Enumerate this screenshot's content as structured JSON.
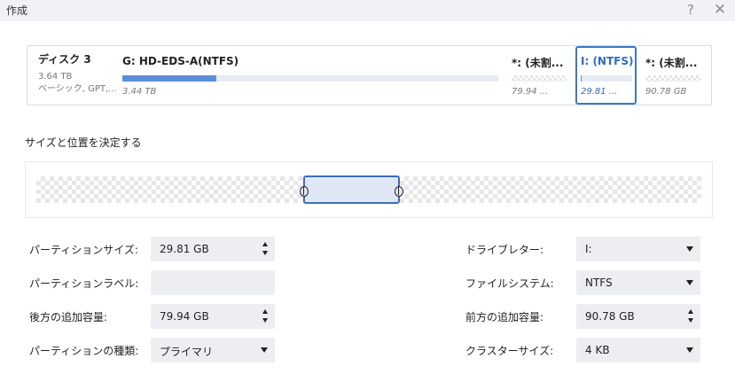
{
  "window": {
    "title": "作成",
    "help_icon": "?",
    "close_icon": "✕"
  },
  "disk": {
    "name": "ディスク 3",
    "size": "3.64 TB",
    "type": "ベーシック, GPT,..."
  },
  "partitions": [
    {
      "name": "G: HD-EDS-A(NTFS)",
      "size": "3.44 TB",
      "used_fraction": 0.25,
      "selected": false,
      "unallocated": false
    },
    {
      "name": "*: (未割...",
      "size": "79.94 ...",
      "selected": false,
      "unallocated": true
    },
    {
      "name": "I: (NTFS)",
      "size": "29.81 ...",
      "used_fraction": 0.02,
      "selected": true,
      "unallocated": false
    },
    {
      "name": "*: (未割...",
      "size": "90.78 GB",
      "selected": false,
      "unallocated": true
    }
  ],
  "section": {
    "label": "サイズと位置を決定する"
  },
  "form": {
    "partition_size": {
      "label": "パーティションサイズ:",
      "value": "29.81 GB"
    },
    "partition_label": {
      "label": "パーティションラベル:",
      "value": ""
    },
    "unallocated_after": {
      "label": "後方の追加容量:",
      "value": "79.94 GB"
    },
    "partition_type": {
      "label": "パーティションの種類:",
      "value": "プライマリ"
    },
    "drive_letter": {
      "label": "ドライブレター:",
      "value": "I:"
    },
    "file_system": {
      "label": "ファイルシステム:",
      "value": "NTFS"
    },
    "unallocated_before": {
      "label": "前方の追加容量:",
      "value": "90.78 GB"
    },
    "cluster_size": {
      "label": "クラスターサイズ:",
      "value": "4 KB"
    }
  }
}
